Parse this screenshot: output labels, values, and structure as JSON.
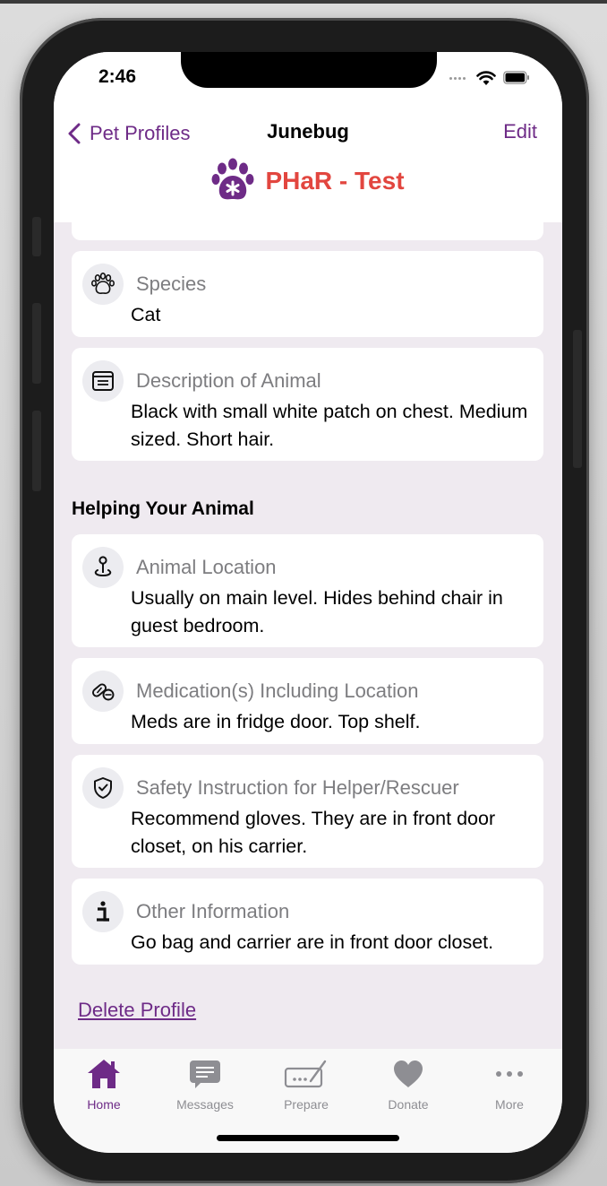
{
  "status_bar": {
    "time": "2:46"
  },
  "nav": {
    "back_label": "Pet Profiles",
    "title": "Junebug",
    "edit_label": "Edit"
  },
  "brand": {
    "name": "PHaR - Test",
    "color": "#e2463f",
    "logo_color": "#6e2b87"
  },
  "accent_color": "#6e2b87",
  "fields": [
    {
      "icon": "paw-icon",
      "label": "Species",
      "value": "Cat"
    },
    {
      "icon": "document-icon",
      "label": "Description of Animal",
      "value": "Black with small white patch on chest. Medium sized. Short hair."
    }
  ],
  "helping_section": {
    "title": "Helping Your Animal",
    "fields": [
      {
        "icon": "location-pin-icon",
        "label": "Animal Location",
        "value": "Usually on main level. Hides behind chair in guest bedroom."
      },
      {
        "icon": "pills-icon",
        "label": "Medication(s) Including Location",
        "value": "Meds are in fridge door. Top shelf."
      },
      {
        "icon": "shield-check-icon",
        "label": "Safety Instruction for Helper/Rescuer",
        "value": "Recommend gloves. They are in front door closet, on his carrier."
      },
      {
        "icon": "info-icon",
        "label": "Other Information",
        "value": "Go bag and carrier are in front door closet."
      }
    ]
  },
  "delete_label": "Delete Profile",
  "tabbar": {
    "tabs": [
      {
        "icon": "home-icon",
        "label": "Home",
        "active": true
      },
      {
        "icon": "message-icon",
        "label": "Messages",
        "active": false
      },
      {
        "icon": "prepare-icon",
        "label": "Prepare",
        "active": false
      },
      {
        "icon": "heart-icon",
        "label": "Donate",
        "active": false
      },
      {
        "icon": "more-icon",
        "label": "More",
        "active": false
      }
    ]
  }
}
